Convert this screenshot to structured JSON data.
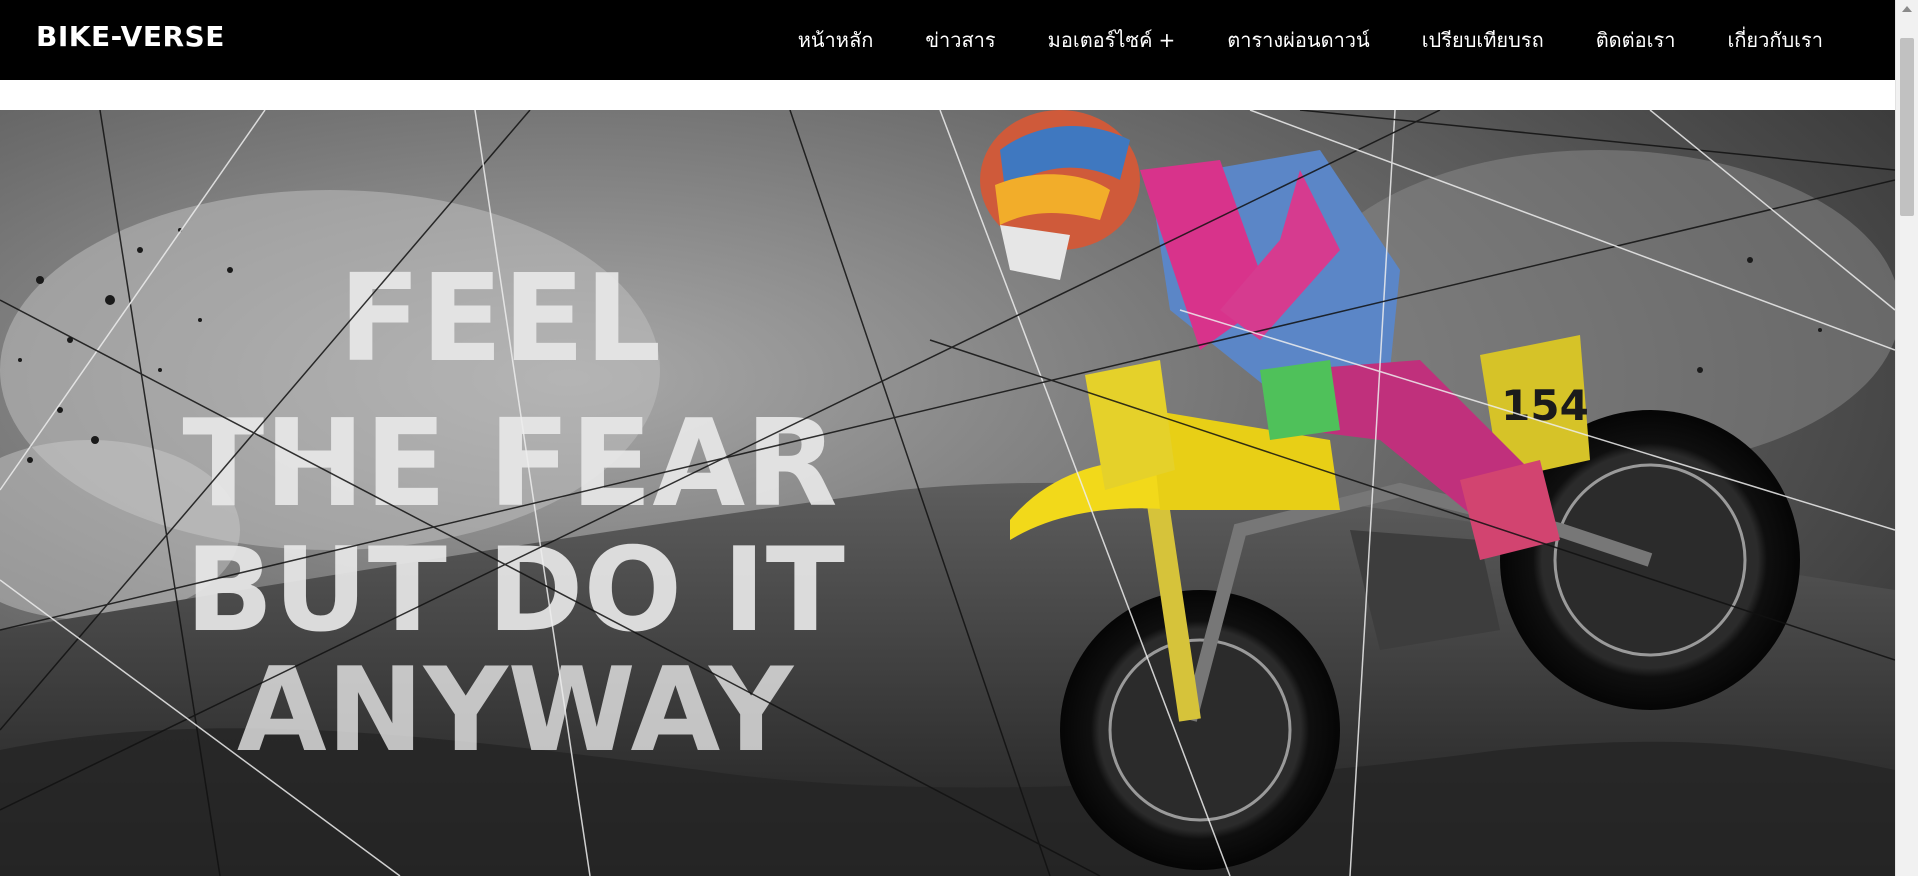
{
  "header": {
    "logo": "BIKE-VERSE",
    "nav": [
      {
        "label": "หน้าหลัก"
      },
      {
        "label": "ข่าวสาร"
      },
      {
        "label": "มอเตอร์ไซค์",
        "suffix": "+"
      },
      {
        "label": "ตารางผ่อนดาวน์"
      },
      {
        "label": "เปรียบเทียบรถ"
      },
      {
        "label": "ติดต่อเรา"
      },
      {
        "label": "เกี่ยวกับเรา"
      }
    ]
  },
  "hero": {
    "lines": [
      "FEEL",
      "THE FEAR",
      "BUT DO IT",
      "ANYWAY"
    ],
    "plate_number": "154"
  },
  "colors": {
    "nav_background": "#000000",
    "nav_text": "#ffffff",
    "page_background": "#ffffff"
  }
}
